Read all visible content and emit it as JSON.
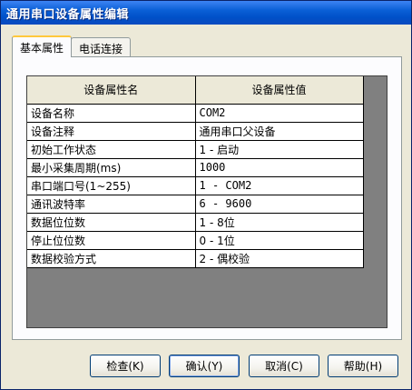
{
  "window": {
    "title": "通用串口设备属性编辑"
  },
  "tabs": [
    {
      "label": "基本属性"
    },
    {
      "label": "电话连接"
    }
  ],
  "grid": {
    "headers": [
      "设备属性名",
      "设备属性值"
    ],
    "rows": [
      {
        "name": "设备名称",
        "value": "COM2"
      },
      {
        "name": "设备注释",
        "value": "通用串口父设备"
      },
      {
        "name": "初始工作状态",
        "value": "1 - 启动"
      },
      {
        "name": "最小采集周期(ms)",
        "value": "1000"
      },
      {
        "name": "串口端口号(1~255)",
        "value": "1 - COM2"
      },
      {
        "name": "通讯波特率",
        "value": "6 - 9600"
      },
      {
        "name": "数据位位数",
        "value": "1 - 8位"
      },
      {
        "name": "停止位位数",
        "value": "0 - 1位"
      },
      {
        "name": "数据校验方式",
        "value": "2 - 偶校验"
      }
    ]
  },
  "buttons": {
    "check": "检查(K)",
    "ok": "确认(Y)",
    "cancel": "取消(C)",
    "help": "帮助(H)"
  }
}
